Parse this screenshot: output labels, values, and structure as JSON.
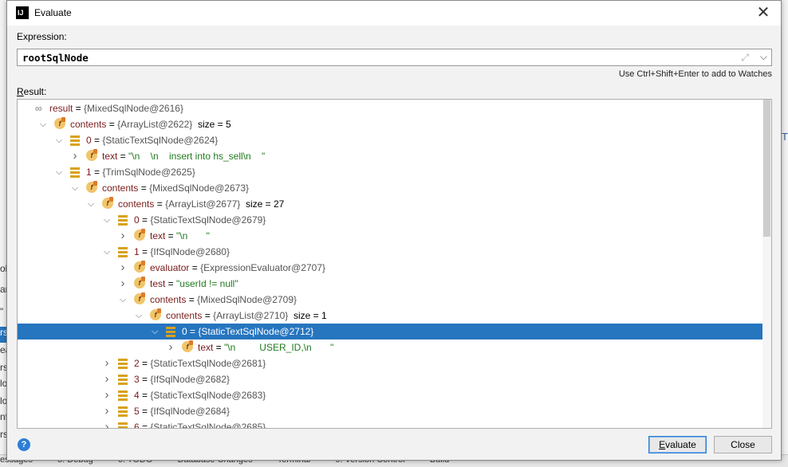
{
  "background": {
    "left_items": [
      "ob",
      "ar",
      "\"",
      "rs",
      "ea",
      "rs",
      "lo",
      "lo",
      "nf",
      "rs"
    ],
    "right_items": [
      "T"
    ],
    "bottom_items": [
      "essages",
      "5: Debug",
      "6: TODO",
      "Database Changes",
      "Terminal",
      "9: Version Control",
      "Build"
    ]
  },
  "dialog": {
    "app_icon": "IJ",
    "title": "Evaluate",
    "close_glyph": "✕",
    "expression_label": "Expression:",
    "expression_value": "rootSqlNode",
    "hint": "Use Ctrl+Shift+Enter to add to Watches",
    "result_label_accel": "R",
    "result_label_rest": "esult:",
    "buttons": {
      "help": "?",
      "evaluate_accel": "E",
      "evaluate_rest": "valuate",
      "close": "Close"
    }
  },
  "tree": [
    {
      "arrow": "",
      "icon": "watch-icon",
      "name": "result",
      "eq": " = ",
      "type": "{MixedSqlNode@2616}",
      "extra": ""
    },
    {
      "arrow": "v",
      "icon": "f",
      "name": "contents",
      "eq": " = ",
      "type": "{ArrayList@2622}",
      "extra": "  size = 5"
    },
    {
      "arrow": "v",
      "icon": "list",
      "name": "0",
      "eq": " = ",
      "type": "{StaticTextSqlNode@2624}",
      "extra": ""
    },
    {
      "arrow": ">",
      "icon": "f",
      "name": "text",
      "eq": " = ",
      "type": "",
      "extra": "",
      "str": "\"\\n    \\n    insert into hs_sell\\n    \""
    },
    {
      "arrow": "v",
      "icon": "list",
      "name": "1",
      "eq": " = ",
      "type": "{TrimSqlNode@2625}",
      "extra": ""
    },
    {
      "arrow": "v",
      "icon": "f",
      "name": "contents",
      "eq": " = ",
      "type": "{MixedSqlNode@2673}",
      "extra": ""
    },
    {
      "arrow": "v",
      "icon": "f",
      "name": "contents",
      "eq": " = ",
      "type": "{ArrayList@2677}",
      "extra": "  size = 27"
    },
    {
      "arrow": "v",
      "icon": "list",
      "name": "0",
      "eq": " = ",
      "type": "{StaticTextSqlNode@2679}",
      "extra": ""
    },
    {
      "arrow": ">",
      "icon": "f",
      "name": "text",
      "eq": " = ",
      "type": "",
      "extra": "",
      "str": "\"\\n       \""
    },
    {
      "arrow": "v",
      "icon": "list",
      "name": "1",
      "eq": " = ",
      "type": "{IfSqlNode@2680}",
      "extra": ""
    },
    {
      "arrow": ">",
      "icon": "f",
      "name": "evaluator",
      "eq": " = ",
      "type": "{ExpressionEvaluator@2707}",
      "extra": ""
    },
    {
      "arrow": ">",
      "icon": "f",
      "name": "test",
      "eq": " = ",
      "type": "",
      "extra": "",
      "str": "\"userId != null\""
    },
    {
      "arrow": "v",
      "icon": "f",
      "name": "contents",
      "eq": " = ",
      "type": "{MixedSqlNode@2709}",
      "extra": ""
    },
    {
      "arrow": "v",
      "icon": "f",
      "name": "contents",
      "eq": " = ",
      "type": "{ArrayList@2710}",
      "extra": "  size = 1"
    },
    {
      "arrow": "v",
      "icon": "list",
      "name": "0",
      "eq": " = ",
      "type": "{StaticTextSqlNode@2712}",
      "extra": "",
      "selected": true
    },
    {
      "arrow": ">",
      "icon": "f",
      "name": "text",
      "eq": " = ",
      "type": "",
      "extra": "",
      "str": "\"\\n         USER_ID,\\n       \""
    },
    {
      "arrow": ">",
      "icon": "list",
      "name": "2",
      "eq": " = ",
      "type": "{StaticTextSqlNode@2681}",
      "extra": ""
    },
    {
      "arrow": ">",
      "icon": "list",
      "name": "3",
      "eq": " = ",
      "type": "{IfSqlNode@2682}",
      "extra": ""
    },
    {
      "arrow": ">",
      "icon": "list",
      "name": "4",
      "eq": " = ",
      "type": "{StaticTextSqlNode@2683}",
      "extra": ""
    },
    {
      "arrow": ">",
      "icon": "list",
      "name": "5",
      "eq": " = ",
      "type": "{IfSqlNode@2684}",
      "extra": ""
    },
    {
      "arrow": ">",
      "icon": "list",
      "name": "6",
      "eq": " = ",
      "type": "{StaticTextSqlNode@2685}",
      "extra": ""
    }
  ]
}
